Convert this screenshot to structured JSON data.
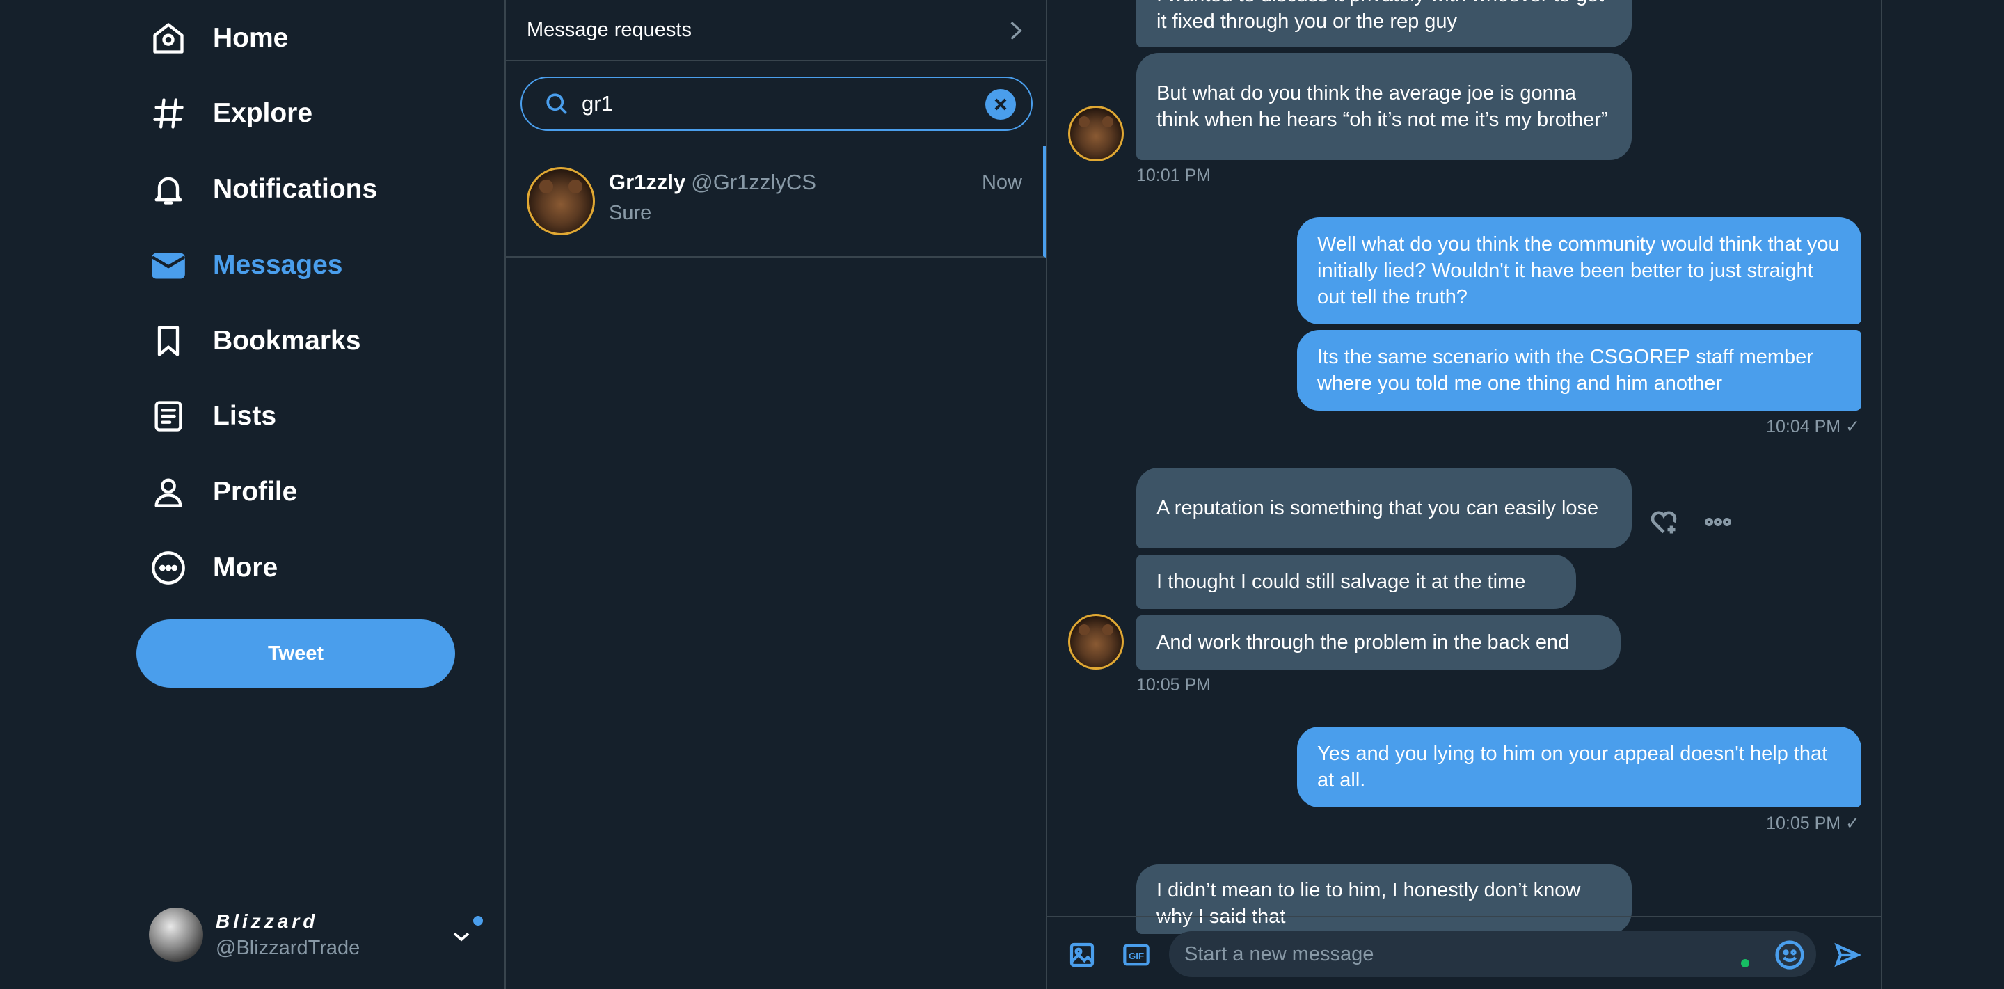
{
  "nav": {
    "home": "Home",
    "explore": "Explore",
    "notifications": "Notifications",
    "messages": "Messages",
    "bookmarks": "Bookmarks",
    "lists": "Lists",
    "profile": "Profile",
    "more": "More",
    "tweet_button": "Tweet",
    "active": "messages"
  },
  "account": {
    "display_name": "Blizzard",
    "handle": "@BlizzardTrade"
  },
  "conversations": {
    "message_requests": "Message requests",
    "search_value": "gr1",
    "results": [
      {
        "name": "Gr1zzly",
        "handle": "@Gr1zzlyCS",
        "time": "Now",
        "preview": "Sure"
      }
    ]
  },
  "chat": {
    "messages": [
      {
        "from": "them",
        "text": "I wanted to discuss it privately with whoever to get it fixed through you or the rep guy"
      },
      {
        "from": "them",
        "text": "But what do you think the average joe is gonna think when he hears “oh it’s not me it’s my brother”"
      },
      {
        "timestamp": "10:01 PM"
      },
      {
        "from": "me",
        "text": "Well what do you think the community would think that you initially lied? Wouldn't it have been better to just straight out tell the truth?"
      },
      {
        "from": "me",
        "text": "Its the same scenario with the CSGOREP staff member where you told me one thing and him another"
      },
      {
        "timestamp": "10:04 PM ✓"
      },
      {
        "from": "them",
        "text": "A reputation is something that you can easily lose"
      },
      {
        "from": "them",
        "text": "I thought I could still salvage it at the time"
      },
      {
        "from": "them",
        "text": "And work through the problem in the back end"
      },
      {
        "timestamp": "10:05 PM"
      },
      {
        "from": "me",
        "text": "Yes and you lying to him on your appeal doesn't help that at all."
      },
      {
        "timestamp": "10:05 PM ✓"
      },
      {
        "from": "them",
        "text": "I didn’t mean to lie to him, I honestly don’t know why I said that"
      }
    ],
    "composer_placeholder": "Start a new message"
  },
  "colors": {
    "background": "#15202b",
    "accent": "#4a9eec",
    "incoming_bubble": "#3d5466",
    "muted_text": "#8899a6",
    "border": "#38444d",
    "online_dot": "#17bf63"
  },
  "icons": [
    "home-icon",
    "hashtag-icon",
    "bell-icon",
    "envelope-icon",
    "bookmark-icon",
    "list-icon",
    "person-icon",
    "more-circle-icon",
    "chevron-right-icon",
    "search-icon",
    "close-icon",
    "heart-plus-icon",
    "more-horizontal-icon",
    "image-icon",
    "gif-icon",
    "emoji-icon",
    "send-icon",
    "chevron-down-icon"
  ]
}
